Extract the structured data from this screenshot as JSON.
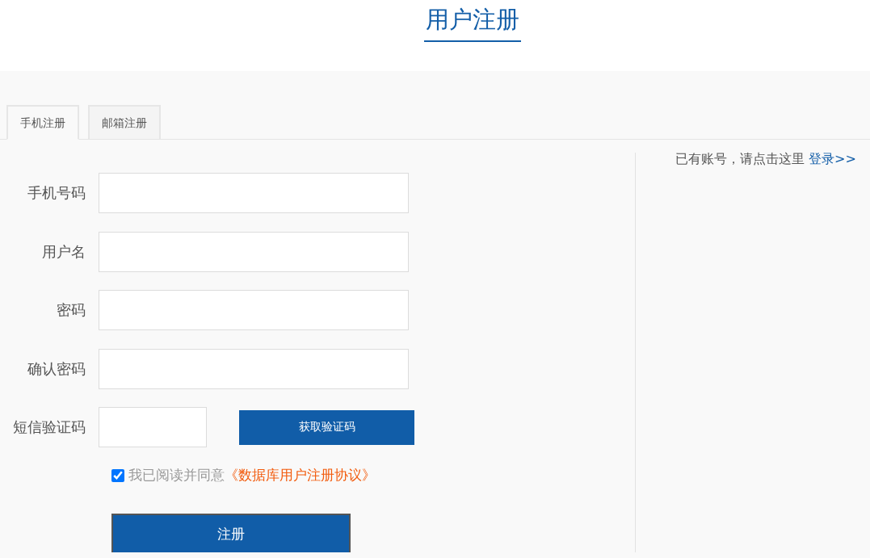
{
  "page_title": "用户注册",
  "tabs": [
    {
      "label": "手机注册",
      "selected": true
    },
    {
      "label": "邮箱注册",
      "selected": false
    }
  ],
  "fields": [
    {
      "kind": "text",
      "label": "手机号码"
    },
    {
      "kind": "text",
      "label": "用户名"
    },
    {
      "kind": "password",
      "label": "密码"
    },
    {
      "kind": "password",
      "label": "确认密码"
    },
    {
      "kind": "code",
      "label": "短信验证码",
      "button": "获取验证码"
    }
  ],
  "agreement": {
    "checked": true,
    "text": "我已阅读并同意",
    "link": "《数据库用户注册协议》"
  },
  "submit": "注册",
  "login_hint": {
    "text": "已有账号，请点击这里",
    "link": "登录>>"
  }
}
